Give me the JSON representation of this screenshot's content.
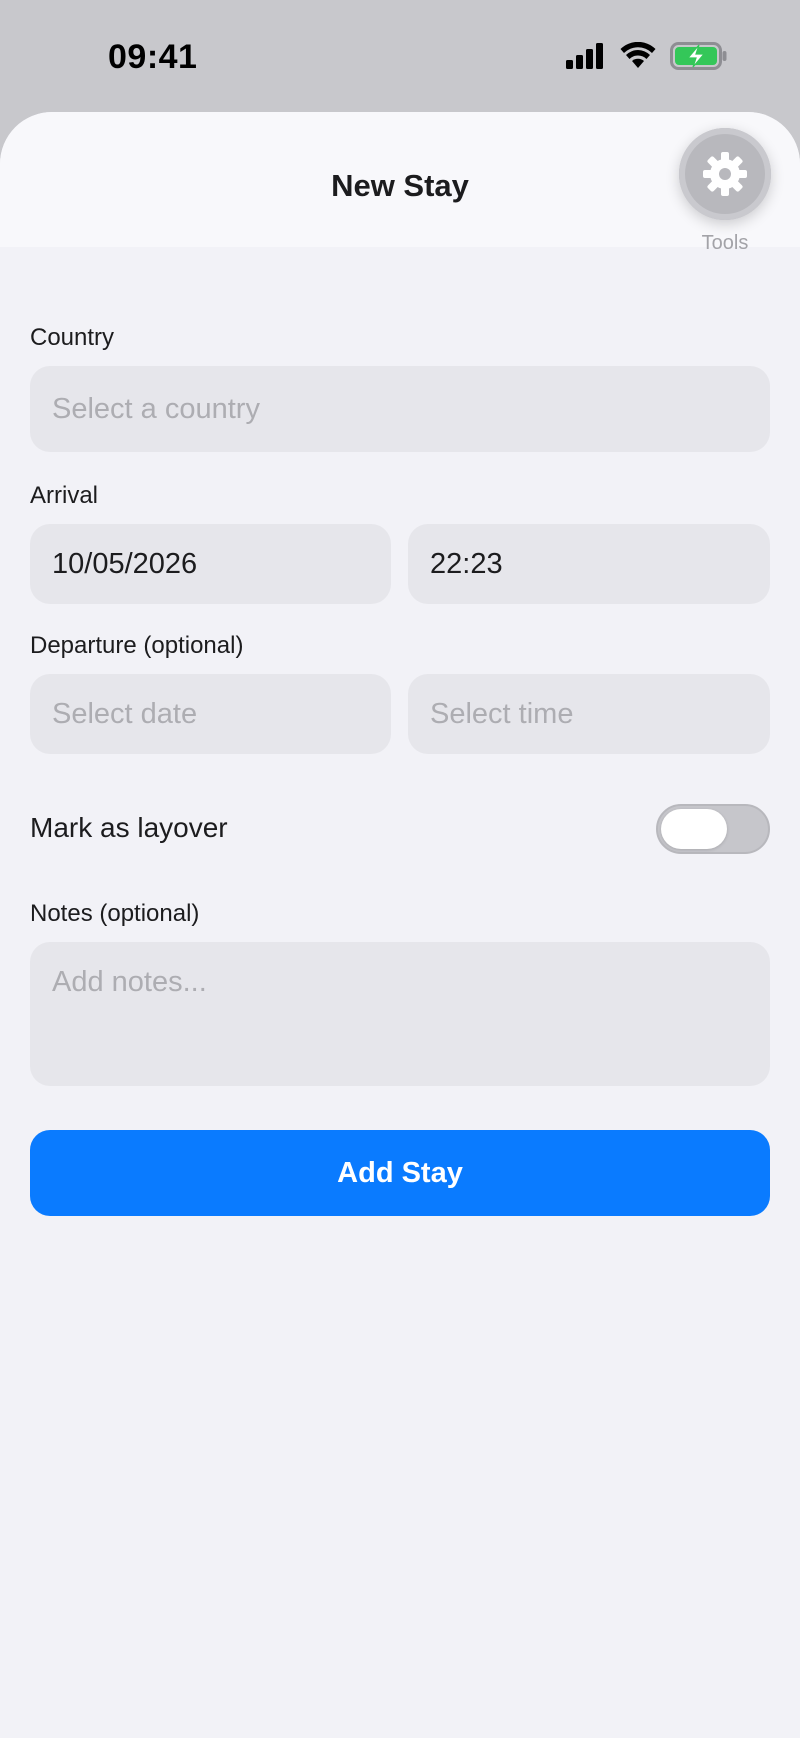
{
  "status_bar": {
    "time": "09:41",
    "icons": [
      "cellular-signal-icon",
      "wifi-icon",
      "battery-charging-icon"
    ],
    "battery_color": "#34c759"
  },
  "sheet": {
    "title": "New Stay",
    "tools": {
      "icon": "gear-icon",
      "label": "Tools"
    }
  },
  "form": {
    "country": {
      "label": "Country",
      "placeholder": "Select a country"
    },
    "arrival": {
      "label": "Arrival",
      "date": "10/05/2026",
      "time": "22:23"
    },
    "departure": {
      "label": "Departure (optional)",
      "date_placeholder": "Select date",
      "time_placeholder": "Select time"
    },
    "layover": {
      "label": "Mark as layover",
      "on": false
    },
    "notes": {
      "label": "Notes (optional)",
      "placeholder": "Add notes..."
    },
    "submit_label": "Add Stay"
  },
  "colors": {
    "accent": "#0a7bff",
    "background": "#f2f2f7",
    "field": "#e6e6eb"
  }
}
